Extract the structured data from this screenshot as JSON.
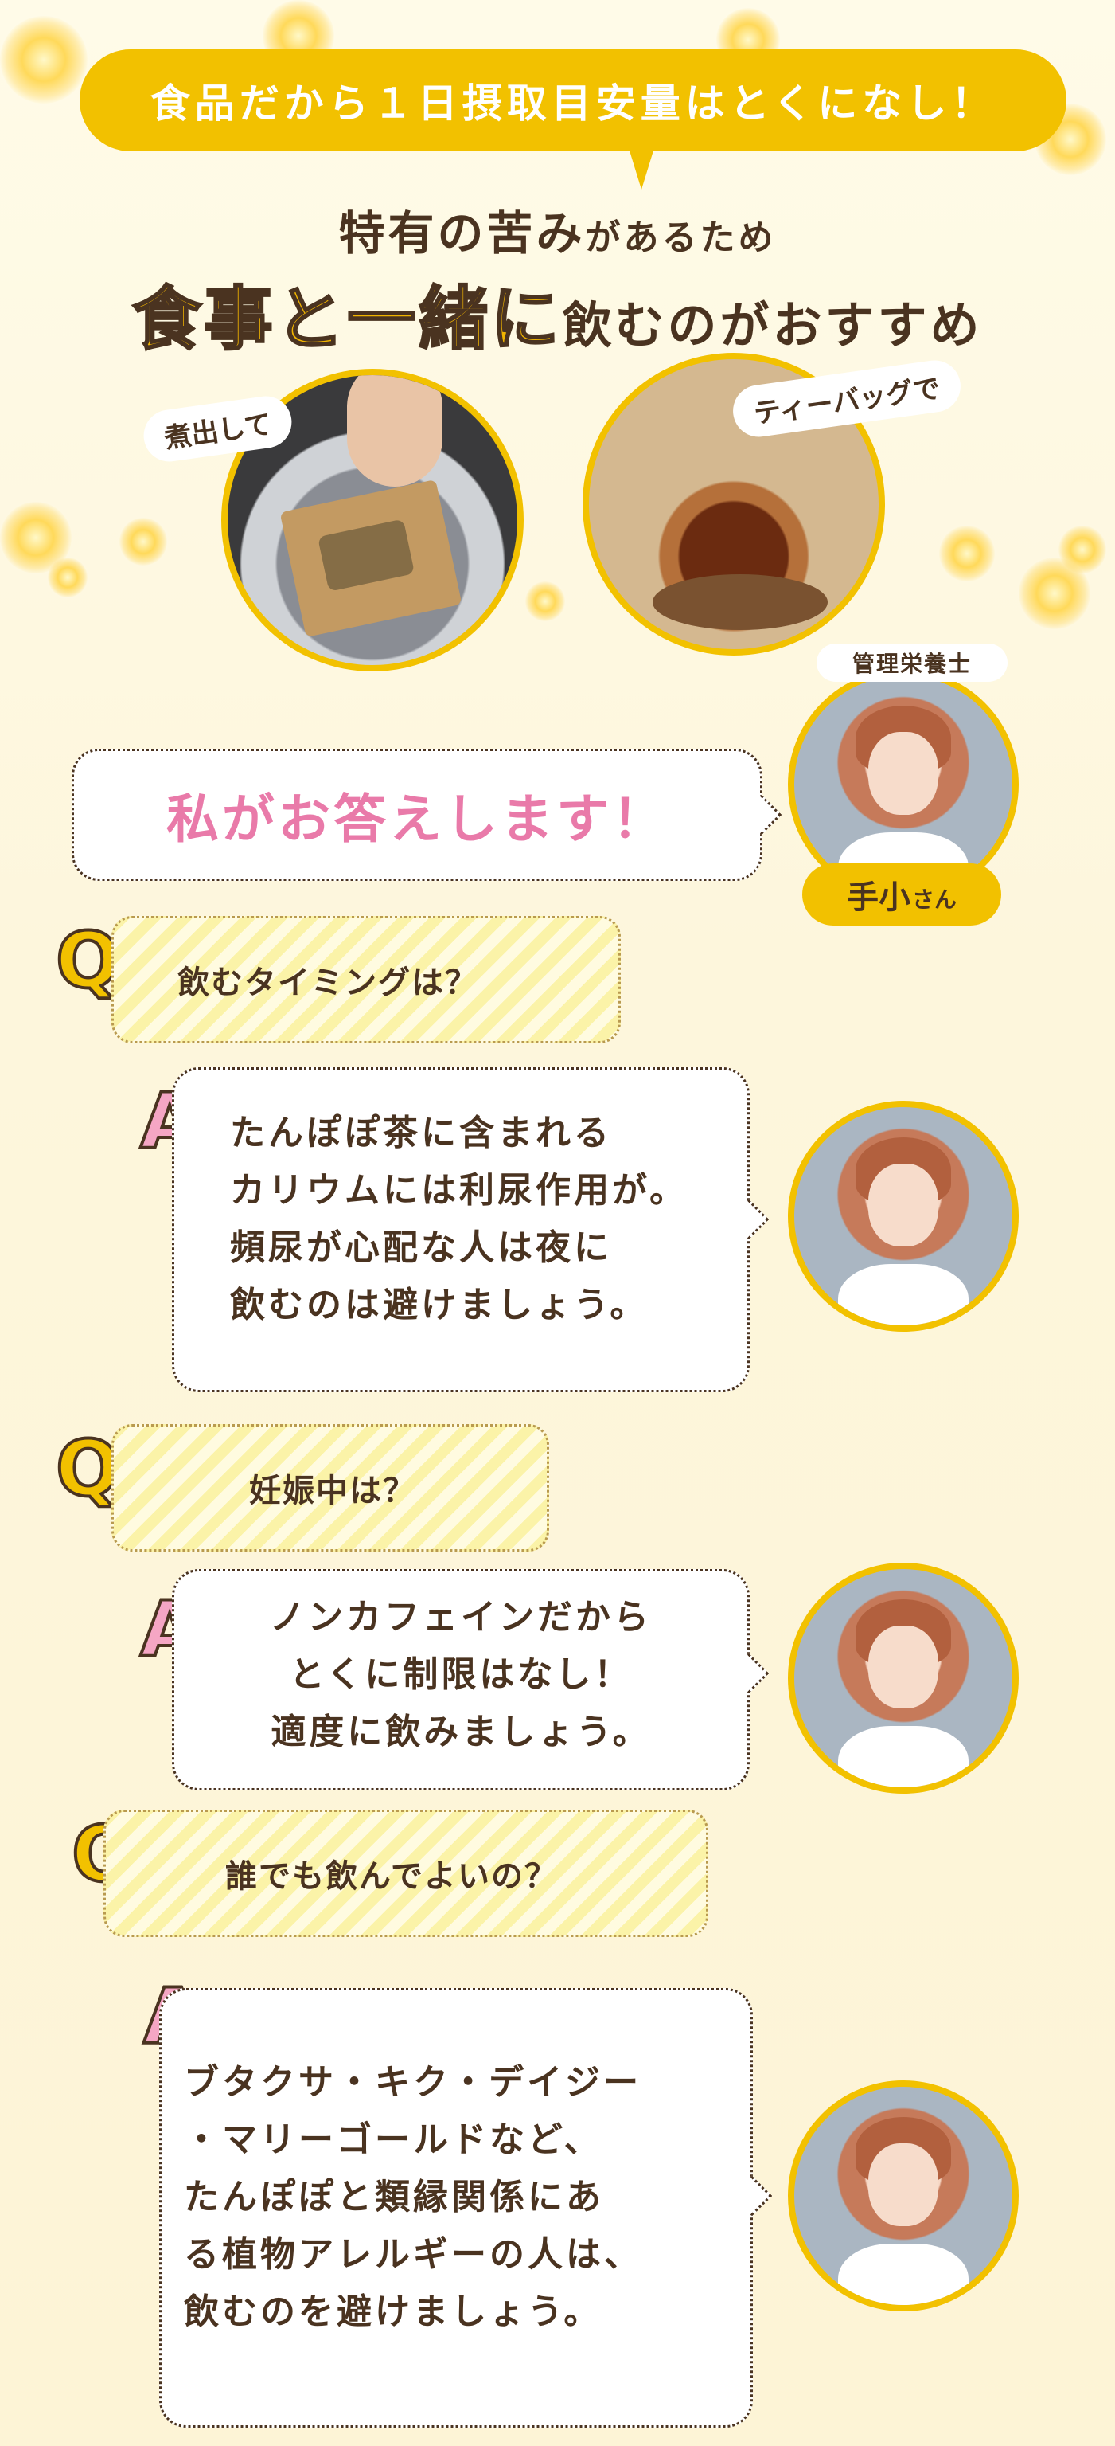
{
  "banner": {
    "text": "食品だから１日摂取目安量はとくになし！"
  },
  "headline": {
    "line1_main": "特有の苦み",
    "line1_small": "があるため",
    "line2_emph": "食事と一緒に",
    "line2_rest": "飲むのがおすすめ"
  },
  "photos": {
    "boil_label": "煮出して",
    "teabag_label": "ティーバッグで"
  },
  "expert": {
    "role": "管理栄養士",
    "name": "手小",
    "honorific": "さん",
    "intro": "私がお答えします！"
  },
  "qa": [
    {
      "q_mark": "Q",
      "question": "飲むタイミングは？",
      "a_mark": "A",
      "answer": [
        "たんぽぽ茶に含まれる",
        "カリウムには利尿作用が。",
        "頻尿が心配な人は夜に",
        "飲むのは避けましょう。"
      ]
    },
    {
      "q_mark": "Q",
      "question": "妊娠中は？",
      "a_mark": "A",
      "answer": [
        "ノンカフェインだから",
        "とくに制限はなし！",
        "適度に飲みましょう。"
      ]
    },
    {
      "q_mark": "Q",
      "question": "誰でも飲んでよいの？",
      "a_mark": "A",
      "answer": [
        "ブタクサ・キク・デイジー",
        "・マリーゴールドなど、",
        "たんぽぽと類縁関係にあ",
        "る植物アレルギーの人は、",
        "飲むのを避けましょう。"
      ]
    }
  ],
  "colors": {
    "accent": "#f2c100",
    "text": "#4a3320",
    "pink": "#e97aa9"
  }
}
